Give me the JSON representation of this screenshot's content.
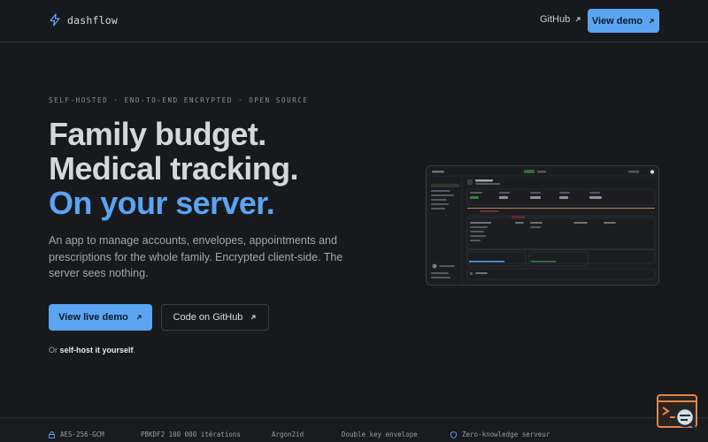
{
  "header": {
    "brand": "dashflow",
    "github_label": "GitHub",
    "demo_label": "View demo"
  },
  "hero": {
    "eyebrow": "SELF-HOSTED · END-TO-END ENCRYPTED · OPEN SOURCE",
    "line1": "Family budget.",
    "line2": "Medical tracking.",
    "line3": "On your server.",
    "lead": "An app to manage accounts, envelopes, appointments and prescriptions for the whole family. Encrypted client-side. The server sees nothing.",
    "primary_cta": "View live demo",
    "secondary_cta": "Code on GitHub",
    "selfhost_prefix": "Or ",
    "selfhost_link": "self-host it yourself",
    "selfhost_suffix": "."
  },
  "footer": {
    "features": [
      "AES-256-GCM",
      "PBKDF2 100 000 itérations",
      "Argon2id",
      "Double key envelope",
      "Zero-knowledge serveur"
    ]
  },
  "colors": {
    "accent": "#5aa4f2",
    "background": "#18191d",
    "border": "#2b2d33"
  },
  "icons": {
    "brand": "lightning-icon",
    "external": "arrow-up-right-icon",
    "lock": "lock-icon",
    "shield": "shield-icon",
    "badge": "terminal-search-icon"
  }
}
